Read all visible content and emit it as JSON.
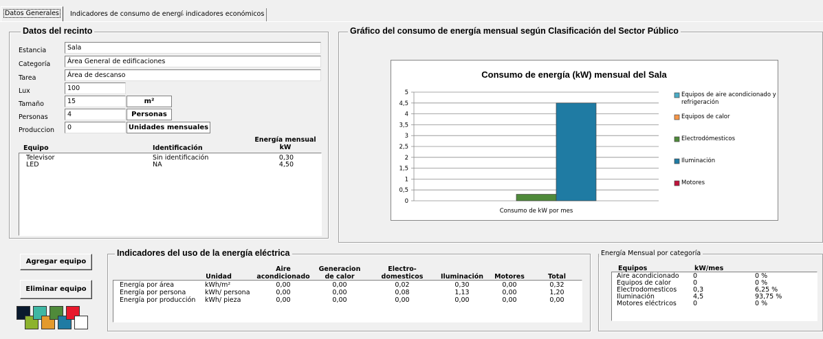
{
  "tabs": [
    "Datos Generales",
    "Indicadores de consumo de energía",
    "indicadores económicos"
  ],
  "recinto": {
    "title": "Datos del recinto",
    "fields": [
      {
        "label": "Estancia",
        "value": "Sala"
      },
      {
        "label": "Categoría",
        "value": "Área General de edificaciones"
      },
      {
        "label": "Tarea",
        "value": "Área de descanso"
      },
      {
        "label": "Lux",
        "value": "100"
      },
      {
        "label": "Tamaño",
        "value": "15",
        "unit": "m²"
      },
      {
        "label": "Personas",
        "value": "4",
        "unit": "Personas"
      },
      {
        "label": "Produccion",
        "value": "0",
        "unit": "Unidades mensuales"
      }
    ],
    "equipos_headers": {
      "equipo": "Equipo",
      "identificacion": "Identificación",
      "energia_l1": "Energía mensual",
      "energia_l2": "kW"
    },
    "equipos": [
      {
        "equipo": "Televisor",
        "identificacion": "Sin identificación",
        "energia": "0,30"
      },
      {
        "equipo": "LED",
        "identificacion": "NA",
        "energia": "4,50"
      }
    ]
  },
  "grafico": {
    "group_title": "Gráfico del consumo de energía mensual según Clasificación del Sector  Público",
    "chart_title": "Consumo de energía (kW) mensual del Sala"
  },
  "chart_data": {
    "type": "bar",
    "title": "Consumo de energía (kW) mensual del Sala",
    "categories": [
      "Consumo de kW por mes"
    ],
    "ylim": [
      0,
      5
    ],
    "yticks": [
      "0",
      "0,5",
      "1",
      "1,5",
      "2",
      "2,5",
      "3",
      "3,5",
      "4",
      "4,5",
      "5"
    ],
    "grid": true,
    "legend_position": "right",
    "series": [
      {
        "name": "Equipos de aire acondicionado y refrigeración",
        "values": [
          0
        ],
        "color": "#4bacc6"
      },
      {
        "name": "Equipos de calor",
        "values": [
          0
        ],
        "color": "#f79646"
      },
      {
        "name": "Electrodómesticos",
        "values": [
          0.3
        ],
        "color": "#4f8a3a"
      },
      {
        "name": "Iluminación",
        "values": [
          4.5
        ],
        "color": "#1f7ba3"
      },
      {
        "name": "Motores",
        "values": [
          0
        ],
        "color": "#c0143c"
      }
    ]
  },
  "buttons": {
    "agregar": "Agregar equipo",
    "eliminar": "Eliminar equipo"
  },
  "indicadores": {
    "title": "Indicadores del uso de la energía eléctrica",
    "headers": [
      {
        "l1": "",
        "l2": "Unidad"
      },
      {
        "l1": "Aire",
        "l2": "acondicionado"
      },
      {
        "l1": "Generacion",
        "l2": "de calor"
      },
      {
        "l1": "Electro-",
        "l2": "domesticos"
      },
      {
        "l1": "",
        "l2": "Iluminación"
      },
      {
        "l1": "",
        "l2": "Motores"
      },
      {
        "l1": "",
        "l2": "Total"
      }
    ],
    "rows": [
      {
        "name": "Energía por área",
        "unidad": "kWh/m²",
        "vals": [
          "0,00",
          "0,00",
          "0,02",
          "0,30",
          "0,00",
          "0,32"
        ]
      },
      {
        "name": "Energía por persona",
        "unidad": "kWh/ persona",
        "vals": [
          "0,00",
          "0,00",
          "0,08",
          "1,13",
          "0,00",
          "1,20"
        ]
      },
      {
        "name": "Energía por producción",
        "unidad": "kWh/ pieza",
        "vals": [
          "0,00",
          "0,00",
          "0,00",
          "0,00",
          "0,00",
          "0,00"
        ]
      }
    ]
  },
  "categoria": {
    "title": "Energía Mensual por categoría",
    "headers": {
      "equipos": "Equipos",
      "kw": "kW/mes"
    },
    "rows": [
      {
        "name": "Aire acondicionado",
        "kw": "0",
        "pct": "0 %"
      },
      {
        "name": "Equipos de calor",
        "kw": "0",
        "pct": "0 %"
      },
      {
        "name": "Electrodomesticos",
        "kw": "0,3",
        "pct": "6,25 %"
      },
      {
        "name": "Iluminación",
        "kw": "4,5",
        "pct": "93,75 %"
      },
      {
        "name": "Motores eléctricos",
        "kw": "0",
        "pct": "0 %"
      }
    ]
  },
  "palette": {
    "colors": [
      "#0a1a2e",
      "#8db32e",
      "#3fb7a3",
      "#e39a2e",
      "#4f8a3a",
      "#1f7ba3",
      "#e8192c",
      "#ffffff"
    ]
  }
}
